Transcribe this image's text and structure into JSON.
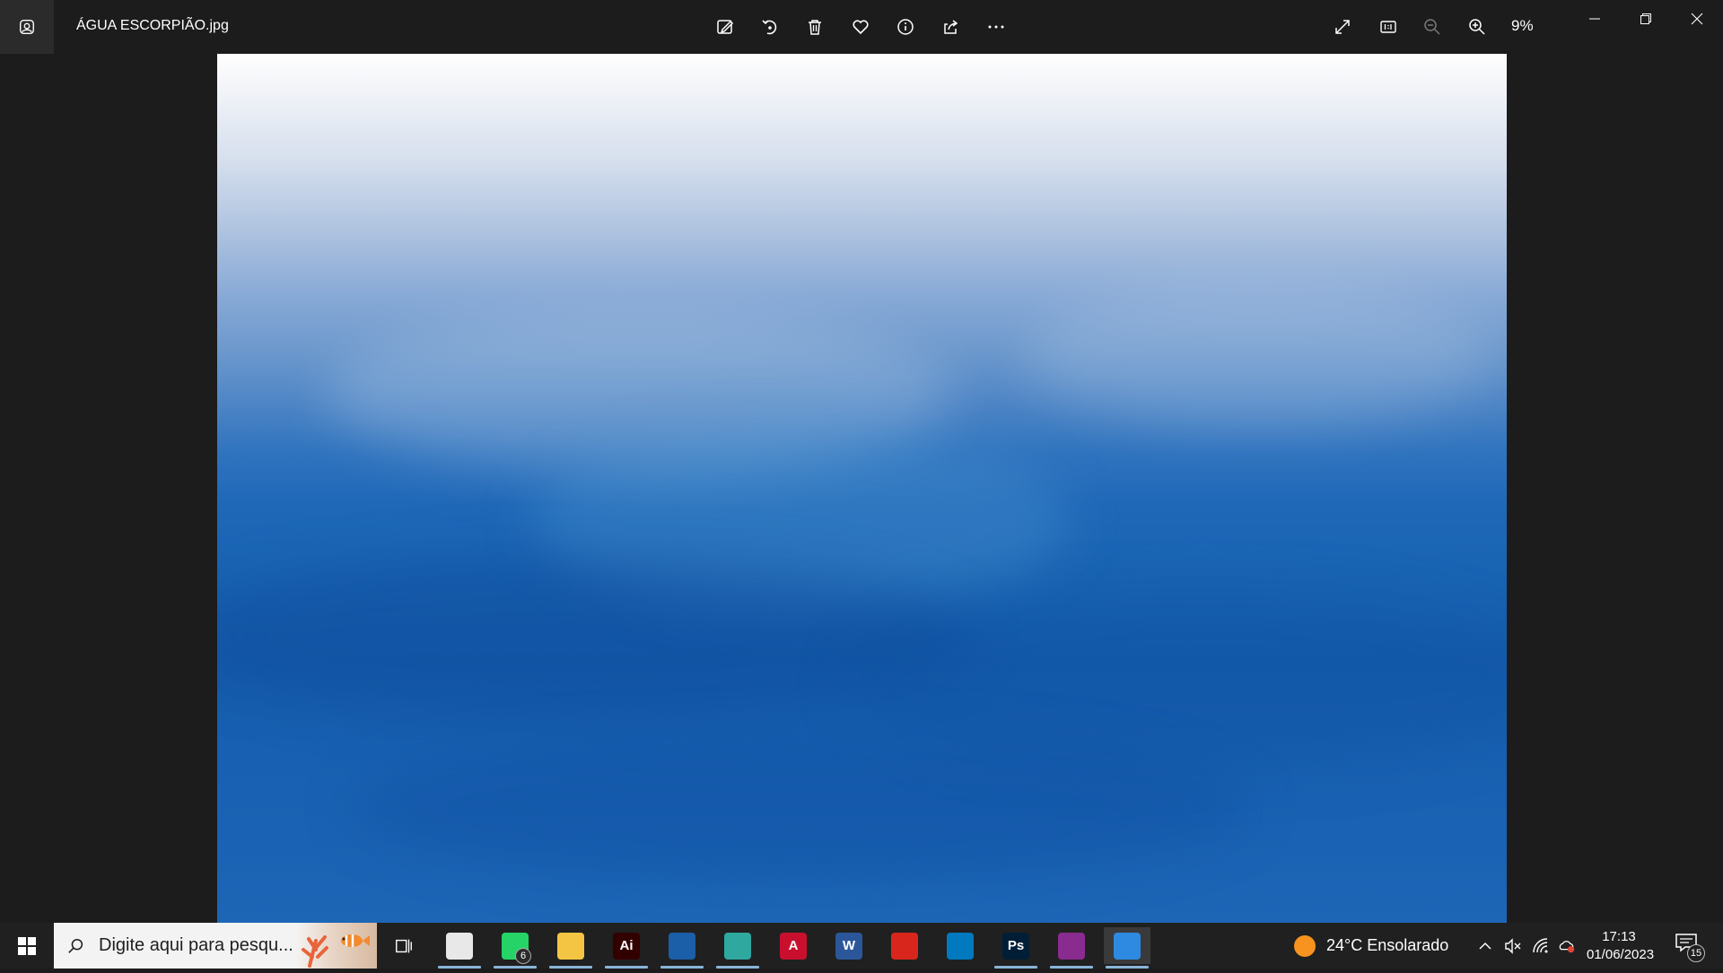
{
  "window": {
    "file_title": "ÁGUA ESCORPIÃO.jpg",
    "zoom_level": "9%"
  },
  "toolbar": {
    "items": [
      {
        "name": "edit-image-icon"
      },
      {
        "name": "rotate-icon"
      },
      {
        "name": "delete-icon"
      },
      {
        "name": "favorite-heart-icon"
      },
      {
        "name": "info-icon"
      },
      {
        "name": "share-icon"
      },
      {
        "name": "more-options-icon"
      }
    ],
    "right_items": [
      {
        "name": "fullscreen-icon"
      },
      {
        "name": "actual-size-icon"
      },
      {
        "name": "zoom-out-icon"
      },
      {
        "name": "zoom-in-icon"
      }
    ]
  },
  "image": {
    "colors": {
      "top": "#ffffff",
      "mid": "#4f86c6",
      "bottom": "#155cad"
    }
  },
  "taskbar": {
    "search_placeholder": "Digite aqui para pesqu...",
    "apps": [
      {
        "name": "chrome-icon",
        "label": "",
        "color": "#e8e8e8",
        "running": true
      },
      {
        "name": "whatsapp-icon",
        "label": "",
        "color": "#25d366",
        "running": true,
        "badge": "6"
      },
      {
        "name": "file-explorer-icon",
        "label": "",
        "color": "#f4c542",
        "running": true
      },
      {
        "name": "illustrator-icon",
        "label": "Ai",
        "color": "#330000",
        "running": true
      },
      {
        "name": "sketchup-icon",
        "label": "",
        "color": "#1b5fa8",
        "running": true
      },
      {
        "name": "edge-icon",
        "label": "",
        "color": "#2fa8a0",
        "running": true
      },
      {
        "name": "autocad-icon",
        "label": "A",
        "color": "#c8102e",
        "running": false
      },
      {
        "name": "word-icon",
        "label": "W",
        "color": "#2b579a",
        "running": false
      },
      {
        "name": "acrobat-icon",
        "label": "",
        "color": "#d9261c",
        "running": false
      },
      {
        "name": "trello-icon",
        "label": "",
        "color": "#0079bf",
        "running": false
      },
      {
        "name": "photoshop-icon",
        "label": "Ps",
        "color": "#001e36",
        "running": true
      },
      {
        "name": "winrar-icon",
        "label": "",
        "color": "#8a2b8f",
        "running": true
      },
      {
        "name": "photos-icon",
        "label": "",
        "color": "#2d8ae0",
        "running": true,
        "active": true
      }
    ],
    "weather": {
      "temp": "24°C",
      "condition": "Ensolarado"
    },
    "clock": {
      "time": "17:13",
      "date": "01/06/2023"
    },
    "notifications": "15"
  }
}
